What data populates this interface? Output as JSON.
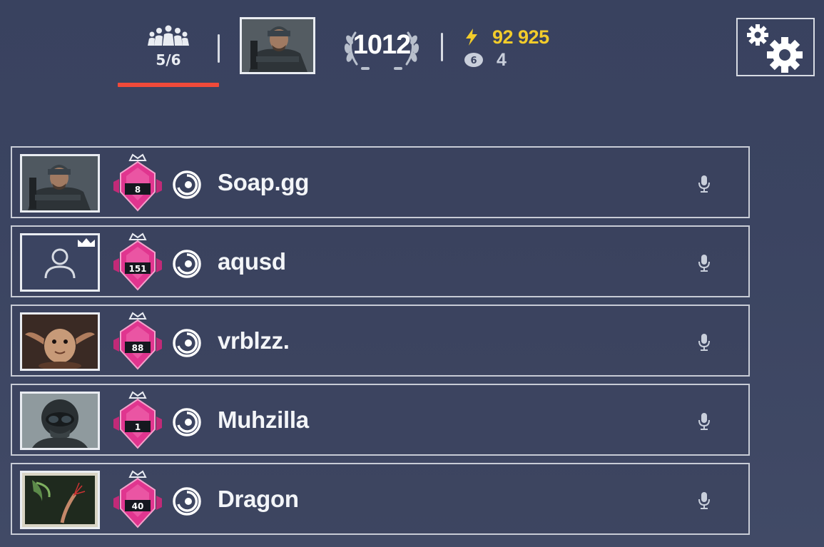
{
  "header": {
    "squad_count": "5/6",
    "level": "1012",
    "renown": "92 925",
    "credits": "4"
  },
  "players": [
    {
      "name": "Soap.gg",
      "clearance": "8",
      "avatar": "operator-portrait",
      "leader": false
    },
    {
      "name": "aqusd",
      "clearance": "151",
      "avatar": "default-user-icon",
      "leader": true
    },
    {
      "name": "vrblzz.",
      "clearance": "88",
      "avatar": "creature-portrait",
      "leader": false
    },
    {
      "name": "Muhzilla",
      "clearance": "1",
      "avatar": "pilot-portrait",
      "leader": false
    },
    {
      "name": "Dragon",
      "clearance": "40",
      "avatar": "plant-portrait",
      "leader": false
    }
  ],
  "colors": {
    "accent_red": "#f04a3a",
    "renown_yellow": "#f2cc2b",
    "rank_pink": "#e0358f"
  }
}
